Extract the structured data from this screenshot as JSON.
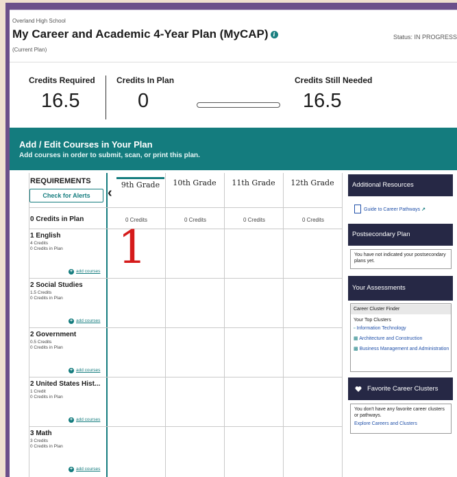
{
  "header": {
    "school": "Overland High School",
    "title": "My Career and Academic 4-Year Plan (MyCAP)",
    "info_icon": "i",
    "plan_label": "(Current Plan)",
    "status": "Status: IN PROGRESS"
  },
  "credits": {
    "required_label": "Credits Required",
    "required_value": "16.5",
    "in_plan_label": "Credits In Plan",
    "in_plan_value": "0",
    "progress_fraction": 0,
    "needed_label": "Credits Still Needed",
    "needed_value": "16.5"
  },
  "banner": {
    "title": "Add / Edit Courses in Your Plan",
    "subtitle": "Add courses in order to submit, scan, or print this plan."
  },
  "grid": {
    "requirements_label": "REQUIREMENTS",
    "check_alerts": "Check for Alerts",
    "credits_in_plan": "0 Credits in Plan",
    "grades": [
      {
        "label": "9th Grade",
        "credits": "0 Credits"
      },
      {
        "label": "10th Grade",
        "credits": "0 Credits"
      },
      {
        "label": "11th Grade",
        "credits": "0 Credits"
      },
      {
        "label": "12th Grade",
        "credits": "0 Credits"
      }
    ],
    "subjects": [
      {
        "name": "1 English",
        "req": "4 Credits",
        "inplan": "0 Credits in Plan",
        "add": "add courses"
      },
      {
        "name": "2 Social Studies",
        "req": "1.5 Credits",
        "inplan": "0 Credits in Plan",
        "add": "add courses"
      },
      {
        "name": "2 Government",
        "req": "0.5 Credits",
        "inplan": "0 Credits in Plan",
        "add": "add courses"
      },
      {
        "name": "2 United States Hist...",
        "req": "1 Credit",
        "inplan": "0 Credits in Plan",
        "add": "add courses"
      },
      {
        "name": "3 Math",
        "req": "3 Credits",
        "inplan": "0 Credits in Plan",
        "add": "add courses"
      }
    ],
    "annotation": "1"
  },
  "sidebar": {
    "resources_title": "Additional Resources",
    "guide_link": "Guide to Career Pathways",
    "postsecondary_title": "Postsecondary Plan",
    "postsecondary_text": "You have not indicated your postsecondary plans yet.",
    "assessments_title": "Your Assessments",
    "cluster_finder": "Career Cluster Finder",
    "top_clusters": "Your Top Clusters",
    "clusters": [
      "Information Technology",
      "Architecture and Construction",
      "Business Management and Administration"
    ],
    "favorites_title": "Favorite Career Clusters",
    "favorites_text": "You don't have any favorite career clusters or pathways.",
    "explore_link": "Explore Careers and Clusters"
  },
  "colors": {
    "teal": "#147c7e",
    "navy": "#262845",
    "annotation_red": "#d51b1b",
    "frame_purple": "#6b4f8a"
  }
}
